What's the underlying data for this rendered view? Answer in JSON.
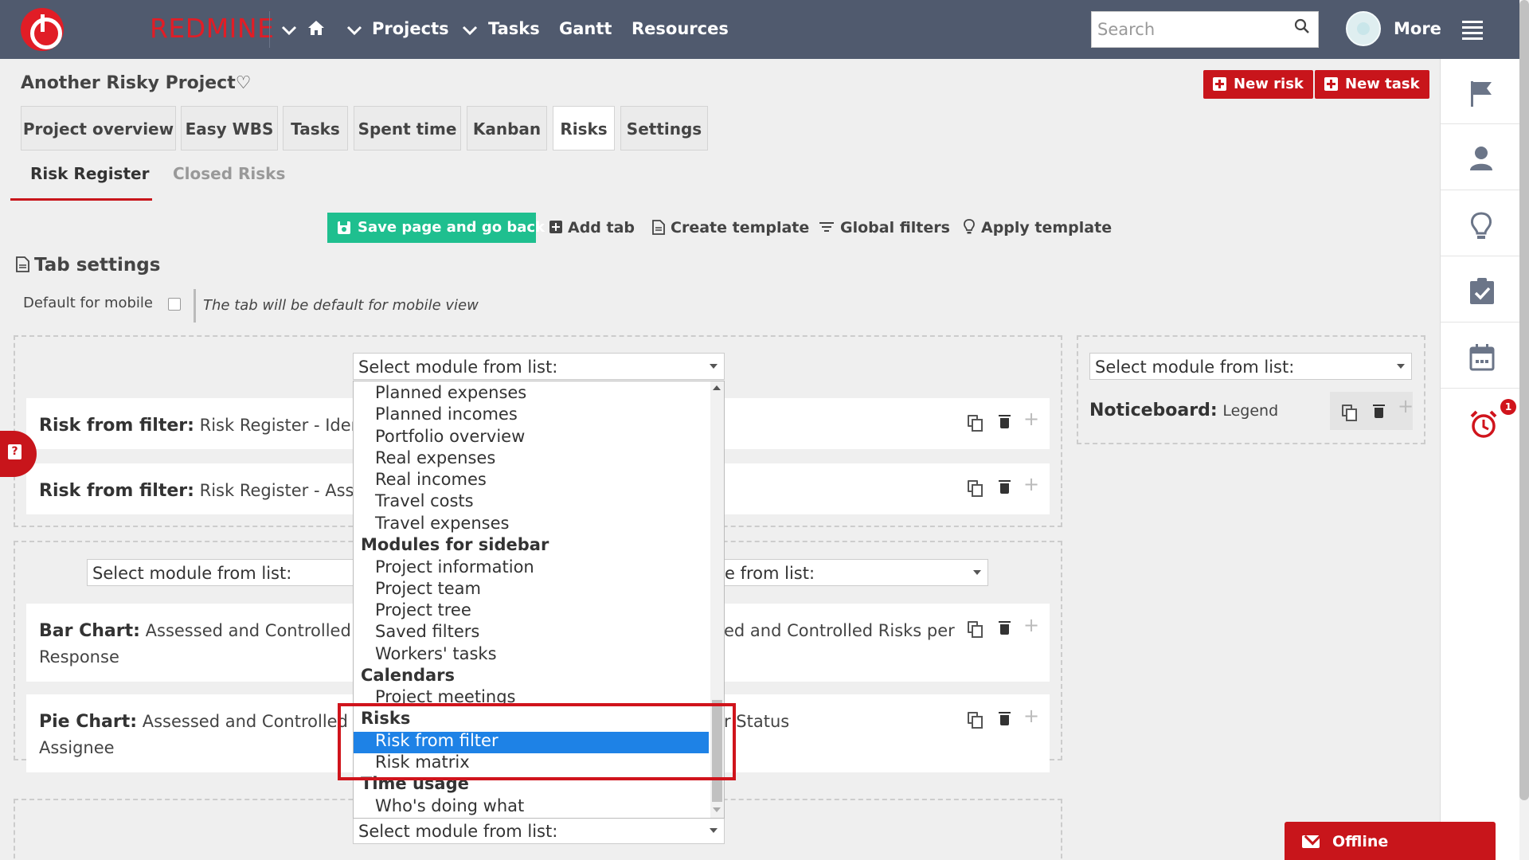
{
  "topbar": {
    "logo_text": "REDMINE",
    "nav": [
      "Projects",
      "Tasks",
      "Gantt",
      "Resources"
    ],
    "search_placeholder": "Search",
    "more_label": "More"
  },
  "project": {
    "title": "Another Risky Project♡",
    "new_risk": "New risk",
    "new_task": "New task",
    "tabs": [
      "Project overview",
      "Easy WBS",
      "Tasks",
      "Spent time",
      "Kanban",
      "Risks",
      "Settings"
    ],
    "active_tab": "Risks",
    "subtabs": [
      "Risk Register",
      "Closed Risks"
    ]
  },
  "toolbar": {
    "save": "Save page and go back",
    "add_tab": "Add tab",
    "create_template": "Create template",
    "global_filters": "Global filters",
    "apply_template": "Apply template"
  },
  "settings": {
    "heading": "Tab settings",
    "default_mobile_label": "Default for mobile",
    "hint": "The tab will be default for mobile view"
  },
  "select_placeholder": "Select module from list:",
  "select_partial": "e from list:",
  "cards": {
    "c1_title": "Risk from filter:",
    "c1_text": "Risk Register - Identi",
    "c2_title": "Risk from filter:",
    "c2_text": "Risk Register - Asses",
    "c3_title": "Bar Chart:",
    "c3_text": "Assessed and Controlled Ri",
    "c3_line2": "Response",
    "c3_right": "ed and Controlled Risks per",
    "c4_title": "Pie Chart:",
    "c4_text": "Assessed and Controlled Ri",
    "c4_line2": "Assignee",
    "c4_right": "r Status",
    "notice_title": "Noticeboard:",
    "notice_text": "Legend"
  },
  "dropdown": {
    "items_a": [
      "Planned expenses",
      "Planned incomes",
      "Portfolio overview",
      "Real expenses",
      "Real incomes",
      "Travel costs",
      "Travel expenses"
    ],
    "group_sidebar": "Modules for sidebar",
    "items_b": [
      "Project information",
      "Project team",
      "Project tree",
      "Saved filters",
      "Workers' tasks"
    ],
    "group_calendars": "Calendars",
    "item_meetings": "Project meetings",
    "group_risks": "Risks",
    "selected": "Risk from filter",
    "item_matrix": "Risk matrix",
    "group_time": "Time usage",
    "item_who": "Who's doing what"
  },
  "sidebar": {
    "badge": "1"
  },
  "offline": "Offline"
}
